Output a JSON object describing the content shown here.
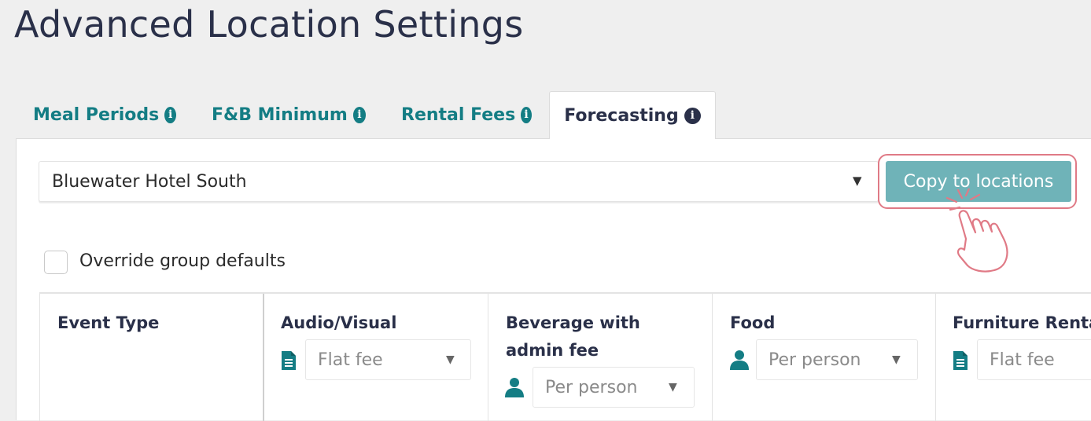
{
  "page": {
    "title": "Advanced Location Settings"
  },
  "tabs": [
    {
      "label": "Meal Periods",
      "info_icon": "info-icon"
    },
    {
      "label": "F&B Minimum",
      "info_icon": "info-icon"
    },
    {
      "label": "Rental Fees",
      "info_icon": "info-icon"
    },
    {
      "label": "Forecasting",
      "info_icon": "info-icon",
      "active": true
    }
  ],
  "location_select": {
    "value": "Bluewater Hotel South",
    "caret": "▼"
  },
  "copy_button": {
    "label": "Copy to locations"
  },
  "override": {
    "label": "Override group defaults",
    "checked": false
  },
  "grid": {
    "columns": [
      {
        "header": "Event Type"
      },
      {
        "header": "Audio/Visual",
        "icon": "document-icon",
        "value": "Flat fee"
      },
      {
        "header_line1": "Beverage with",
        "header_line2": "admin fee",
        "icon": "person-icon",
        "value": "Per person"
      },
      {
        "header": "Food",
        "icon": "person-icon",
        "value": "Per person"
      },
      {
        "header": "Furniture Rental",
        "icon": "document-icon",
        "value": "Flat fee"
      }
    ]
  },
  "colors": {
    "teal": "#147d84",
    "button": "#6fb3b8",
    "highlight": "#e07a86",
    "title": "#2a3049"
  }
}
